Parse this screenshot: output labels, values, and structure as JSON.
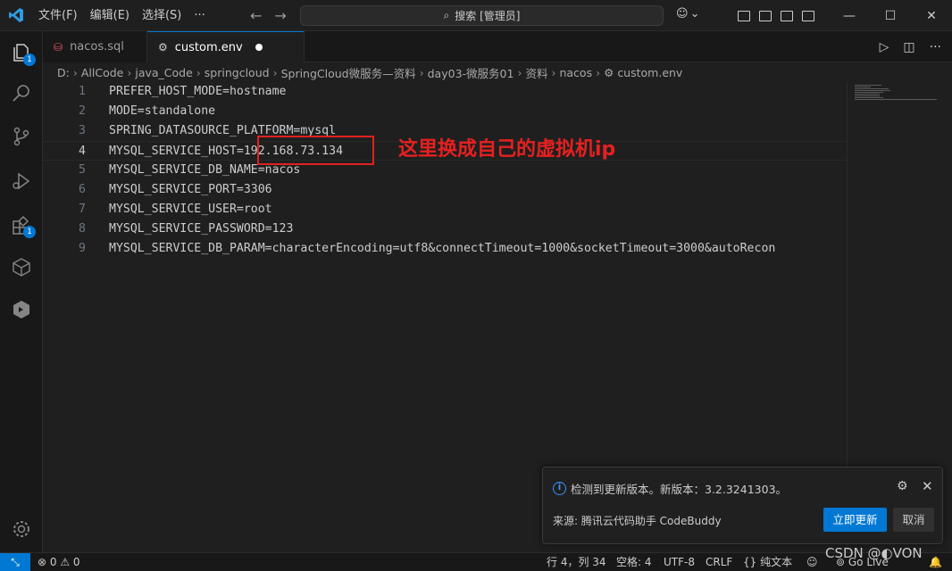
{
  "titlebar": {
    "menus": [
      "文件(F)",
      "编辑(E)",
      "选择(S)",
      "···"
    ],
    "search": "搜索 [管理员]"
  },
  "activity_badges": {
    "explorer": "1",
    "extensions": "1"
  },
  "tabs": [
    {
      "label": "nacos.sql",
      "active": false
    },
    {
      "label": "custom.env",
      "active": true,
      "dirty": true
    }
  ],
  "breadcrumb": [
    "D:",
    "AllCode",
    "java_Code",
    "springcloud",
    "SpringCloud微服务—资料",
    "day03-微服务01",
    "资料",
    "nacos",
    "custom.env"
  ],
  "editor": {
    "current_line": 4,
    "lines": [
      {
        "num": "1",
        "text": "PREFER_HOST_MODE=hostname"
      },
      {
        "num": "2",
        "text": "MODE=standalone"
      },
      {
        "num": "3",
        "text": "SPRING_DATASOURCE_PLATFORM=mysql"
      },
      {
        "num": "4",
        "text": "MYSQL_SERVICE_HOST=192.168.73.134"
      },
      {
        "num": "5",
        "text": "MYSQL_SERVICE_DB_NAME=nacos"
      },
      {
        "num": "6",
        "text": "MYSQL_SERVICE_PORT=3306"
      },
      {
        "num": "7",
        "text": "MYSQL_SERVICE_USER=root"
      },
      {
        "num": "8",
        "text": "MYSQL_SERVICE_PASSWORD=123"
      },
      {
        "num": "9",
        "text": "MYSQL_SERVICE_DB_PARAM=characterEncoding=utf8&connectTimeout=1000&socketTimeout=3000&autoRecon"
      }
    ]
  },
  "annotation": "这里换成自己的虚拟机ip",
  "notification": {
    "message": "检测到更新版本。新版本：3.2.3241303。",
    "source": "来源: 腾讯云代码助手 CodeBuddy",
    "primary_button": "立即更新",
    "secondary_button": "取消"
  },
  "statusbar": {
    "problems": "⊗ 0 ⚠ 0",
    "position": "行 4，列 34",
    "spaces": "空格: 4",
    "encoding": "UTF-8",
    "eol": "CRLF",
    "language": "{} 纯文本",
    "golive": "Go Live"
  },
  "watermark": "CSDN @◐VON",
  "colors": {
    "accent": "#0078d4",
    "annotation": "#e62020"
  }
}
